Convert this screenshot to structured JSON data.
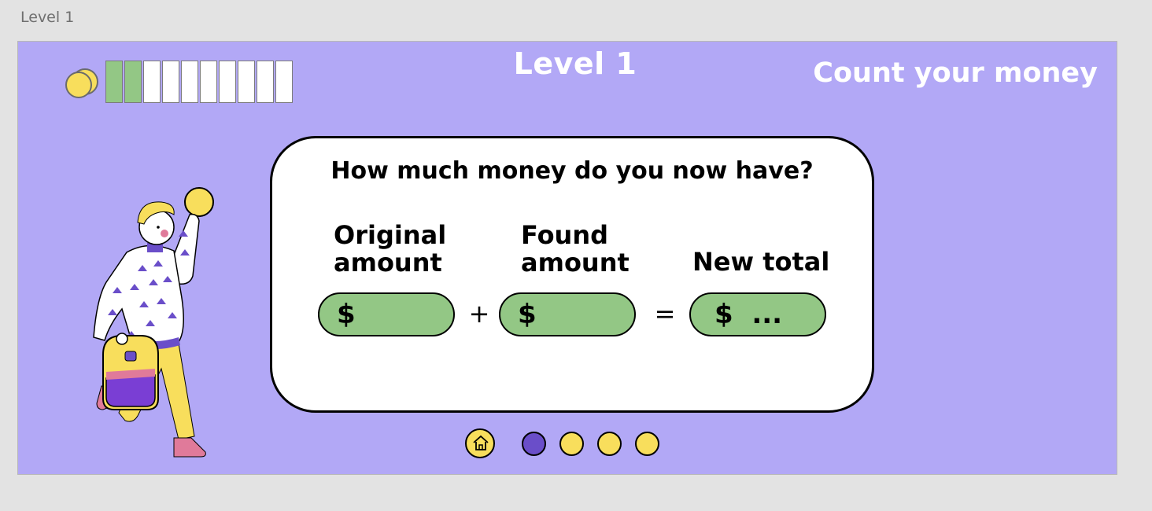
{
  "frame": {
    "label": "Level 1"
  },
  "header": {
    "level_title": "Level 1",
    "game_title": "Count your money",
    "progress": {
      "filled": 2,
      "total": 10
    }
  },
  "card": {
    "question": "How much money do you now have?",
    "columns": [
      {
        "label_line1": "Original",
        "label_line2": "amount",
        "value": "$"
      },
      {
        "label_line1": "Found",
        "label_line2": "amount",
        "value": "$"
      },
      {
        "label_line1": "New total",
        "label_line2": "",
        "value": "$  ..."
      }
    ],
    "plus": "+",
    "equals": "="
  },
  "nav": {
    "home_icon": "home-icon",
    "dots": [
      {
        "state": "active"
      },
      {
        "state": "inactive"
      },
      {
        "state": "inactive"
      },
      {
        "state": "inactive"
      }
    ]
  },
  "colors": {
    "background": "#b2a8f6",
    "green": "#93c785",
    "yellow": "#f8de5c",
    "purple": "#6a4ec9"
  }
}
